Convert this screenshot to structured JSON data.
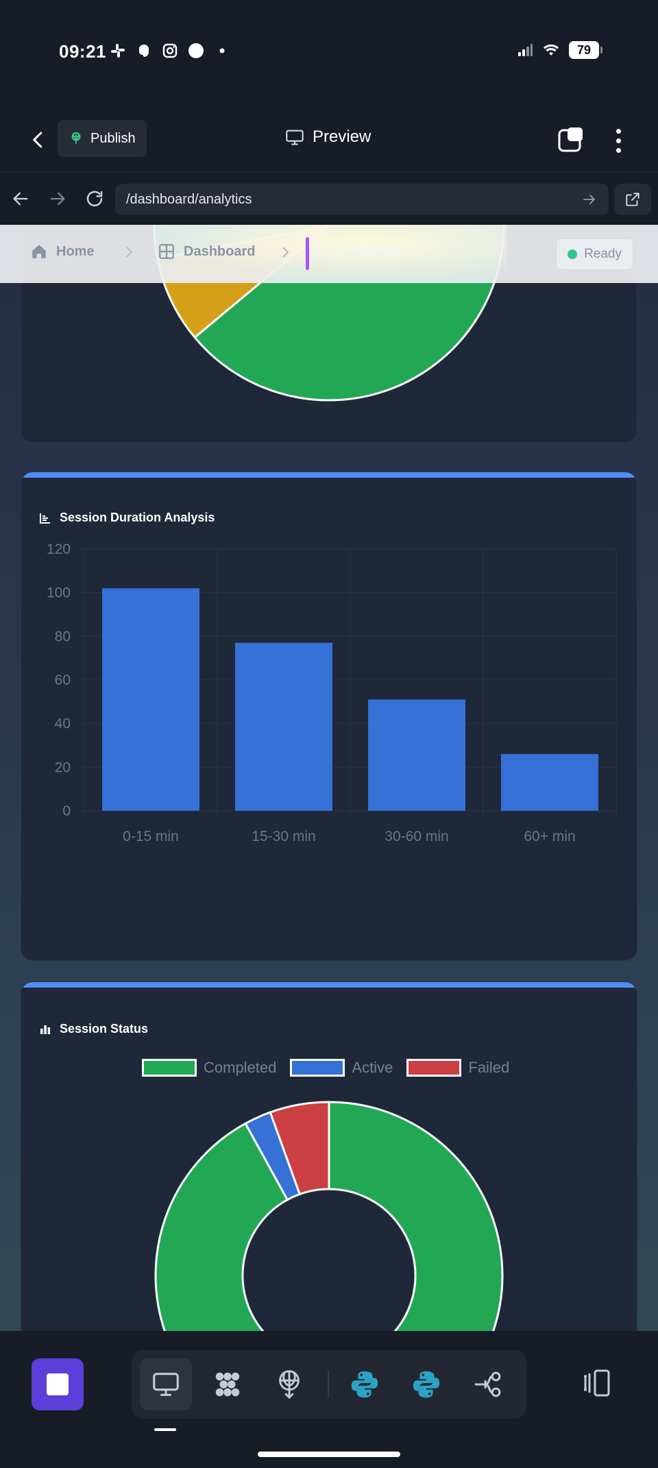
{
  "status_bar": {
    "time": "09:21",
    "battery": "79",
    "left_icons": [
      "slack-icon",
      "threads-icon",
      "instagram-icon",
      "circle-icon",
      "dot-icon"
    ],
    "right_icons": [
      "signal-icon",
      "wifi-icon",
      "battery-icon"
    ]
  },
  "header": {
    "publish_label": "Publish",
    "title": "Preview"
  },
  "browser": {
    "url": "/dashboard/analytics"
  },
  "breadcrumb": {
    "items": [
      {
        "label": "Home",
        "icon": "home-icon"
      },
      {
        "label": "Dashboard",
        "icon": "dashboard-icon"
      },
      {
        "label": "Analytics",
        "icon": "analytics-icon"
      }
    ],
    "status": "Ready",
    "status_color": "#34c28c"
  },
  "cards": {
    "duration_title": "Session Duration Analysis",
    "status_title": "Session Status"
  },
  "colors": {
    "accent": "#4f8ef7",
    "bar": "#3571d6",
    "completed": "#22a855",
    "active": "#3571d6",
    "failed": "#cc3f42",
    "top_pie_other": "#d4a017",
    "stop_button": "#5b3fd8"
  },
  "chart_data": [
    {
      "type": "pie",
      "title": "",
      "note": "partially visible, scrolled above viewport",
      "slices": [
        {
          "color": "#22a855",
          "value": 92
        },
        {
          "color": "#d4a017",
          "value": 8
        }
      ]
    },
    {
      "type": "bar",
      "title": "Session Duration Analysis",
      "categories": [
        "0-15 min",
        "15-30 min",
        "30-60 min",
        "60+ min"
      ],
      "values": [
        102,
        77,
        51,
        26
      ],
      "ylim": [
        0,
        120
      ],
      "yticks": [
        "0",
        "20",
        "40",
        "60",
        "80",
        "100",
        "120"
      ],
      "grid": true,
      "xlabel": "",
      "ylabel": ""
    },
    {
      "type": "pie",
      "variant": "doughnut",
      "title": "Session Status",
      "categories": [
        "Completed",
        "Active",
        "Failed"
      ],
      "values": [
        92,
        2.5,
        5.5
      ],
      "legend": "top"
    }
  ],
  "dock": {
    "tools": [
      "monitor-icon",
      "apps-icon",
      "deploy-icon",
      "python-icon",
      "python-icon",
      "git-branch-icon"
    ],
    "panel_icon": "panel-toggle-icon"
  }
}
